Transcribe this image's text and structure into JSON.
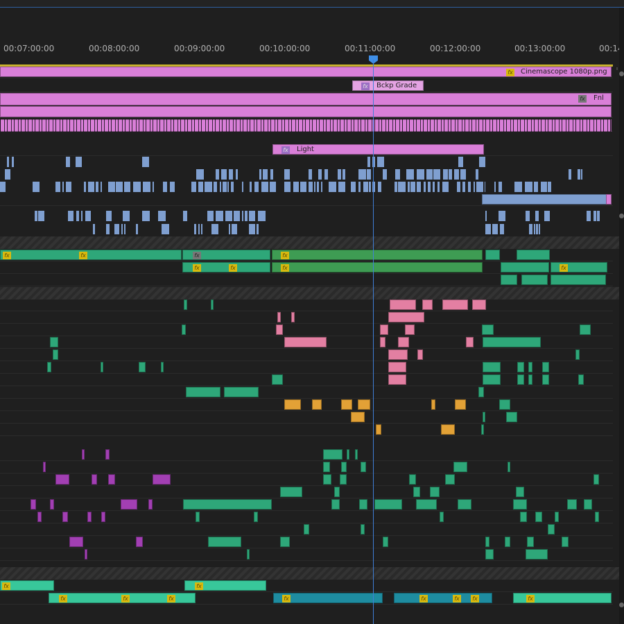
{
  "ruler": {
    "timecodes": [
      "00:07:00:00",
      "00:08:00:00",
      "00:09:00:00",
      "00:10:00:00",
      "00:11:00:00",
      "00:12:00:00",
      "00:13:00:00",
      "00:14"
    ]
  },
  "colors": {
    "adjustment": "#d97fd8",
    "video_blue": "#7f9fd0",
    "audio_green": "#2ea779",
    "audio_lightgreen": "#38c79a",
    "pink": "#e37fa2",
    "orange": "#e2a136",
    "teal": "#1e8ca0",
    "purple": "#a23fb3",
    "playhead": "#3f7fd8"
  },
  "clips": {
    "cinemascope": "Cinemascope 1080p.png",
    "bckp_grade": "Bckp Grade",
    "fnl": "Fnl",
    "light": "Light"
  },
  "playhead_timecode": "00:11:00:00"
}
